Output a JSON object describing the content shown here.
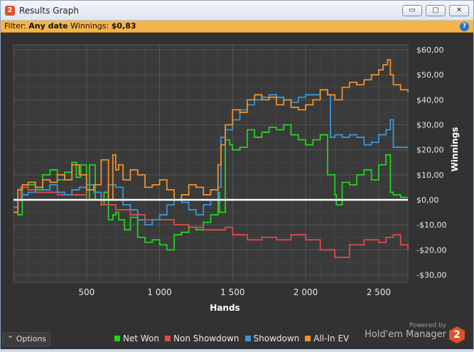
{
  "window": {
    "title": "Results Graph",
    "minimize": "▭",
    "maximize": "▢",
    "close": "✕",
    "app_icon": "2"
  },
  "filter": {
    "prefix": "Filter:",
    "value": "Any date",
    "winnings_label": "Winnings:",
    "winnings_value": "$0,83"
  },
  "help_icon": "?",
  "options_label": "Options",
  "brand": {
    "powered": "Powered by",
    "name": "Hold'em Manager",
    "logo": "2"
  },
  "colors": {
    "net_won": "#22d322",
    "non_showdown": "#e04a4a",
    "showdown": "#3b96d6",
    "all_in_ev": "#f0902c",
    "zero_line": "#ffffff"
  },
  "chart_data": {
    "type": "line",
    "title": "",
    "xlabel": "Hands",
    "ylabel": "Winnings",
    "xlim": [
      0,
      2700
    ],
    "ylim": [
      -33,
      62
    ],
    "xticks": [
      500,
      1000,
      1500,
      2000,
      2500
    ],
    "xtick_labels": [
      "500",
      "1 000",
      "1 500",
      "2 000",
      "2 500"
    ],
    "yticks": [
      60,
      50,
      40,
      30,
      20,
      10,
      0,
      -10,
      -20,
      -30
    ],
    "ytick_labels": [
      "$60,00",
      "$50,00",
      "$40,00",
      "$30,00",
      "$20,00",
      "$10,00",
      "$0,00",
      "-$10,00",
      "-$20,00",
      "-$30,00"
    ],
    "legend": {
      "position": "bottom"
    },
    "series": [
      {
        "name": "Net Won",
        "color": "#22d322",
        "x": [
          0,
          30,
          60,
          100,
          150,
          200,
          250,
          300,
          350,
          400,
          430,
          460,
          500,
          520,
          560,
          600,
          620,
          650,
          680,
          700,
          720,
          760,
          800,
          850,
          900,
          950,
          1000,
          1050,
          1100,
          1150,
          1200,
          1250,
          1300,
          1350,
          1400,
          1410,
          1450,
          1480,
          1500,
          1550,
          1600,
          1650,
          1700,
          1750,
          1800,
          1850,
          1900,
          1950,
          2000,
          2050,
          2100,
          2150,
          2200,
          2210,
          2250,
          2300,
          2350,
          2400,
          2450,
          2500,
          2550,
          2580,
          2600,
          2650,
          2700
        ],
        "y": [
          -3,
          -6,
          5,
          6,
          4,
          10,
          12,
          8,
          11,
          15,
          9,
          14,
          0,
          14,
          0,
          -2,
          3,
          -8,
          -6,
          -5,
          -8,
          -12,
          -7,
          -15,
          -17,
          -16,
          -18,
          -20,
          -14,
          -13,
          -11,
          -12,
          -9,
          -6,
          3,
          -5,
          24,
          22,
          20,
          21,
          28,
          25,
          27,
          29,
          28,
          30,
          26,
          24,
          22,
          24,
          26,
          10,
          2,
          -2,
          7,
          6,
          10,
          12,
          8,
          14,
          18,
          3,
          2,
          1,
          1
        ]
      },
      {
        "name": "Non Showdown",
        "color": "#e04a4a",
        "x": [
          0,
          50,
          100,
          150,
          200,
          300,
          400,
          500,
          600,
          700,
          800,
          900,
          1000,
          1100,
          1200,
          1300,
          1400,
          1450,
          1500,
          1600,
          1700,
          1800,
          1900,
          2000,
          2100,
          2200,
          2300,
          2400,
          2500,
          2550,
          2600,
          2650,
          2700
        ],
        "y": [
          0,
          5,
          4,
          3,
          3,
          2,
          2,
          0,
          -2,
          -4,
          -6,
          -8,
          -8,
          -10,
          -11,
          -12,
          -12,
          -11,
          -14,
          -16,
          -15,
          -16,
          -14,
          -16,
          -20,
          -23,
          -18,
          -16,
          -17,
          -15,
          -14,
          -18,
          -20
        ]
      },
      {
        "name": "Showdown",
        "color": "#3b96d6",
        "x": [
          0,
          30,
          60,
          100,
          150,
          200,
          250,
          300,
          350,
          400,
          450,
          500,
          550,
          600,
          650,
          700,
          750,
          800,
          850,
          900,
          950,
          1000,
          1050,
          1100,
          1150,
          1200,
          1250,
          1300,
          1350,
          1400,
          1420,
          1450,
          1500,
          1550,
          1600,
          1650,
          1700,
          1750,
          1800,
          1850,
          1900,
          1950,
          2000,
          2050,
          2100,
          2150,
          2170,
          2200,
          2250,
          2300,
          2350,
          2400,
          2450,
          2500,
          2550,
          2580,
          2600,
          2650,
          2700
        ],
        "y": [
          -3,
          0,
          2,
          3,
          5,
          4,
          6,
          3,
          2,
          4,
          5,
          6,
          3,
          0,
          6,
          5,
          -2,
          -4,
          -8,
          -10,
          -8,
          -6,
          -2,
          0,
          -1,
          -4,
          -6,
          -2,
          0,
          5,
          25,
          28,
          32,
          36,
          38,
          40,
          41,
          42,
          41,
          40,
          39,
          41,
          42,
          42,
          44,
          42,
          25,
          26,
          25,
          26,
          25,
          22,
          23,
          26,
          28,
          32,
          21,
          21,
          21
        ]
      },
      {
        "name": "All-In EV",
        "color": "#f0902c",
        "x": [
          0,
          30,
          60,
          100,
          150,
          200,
          250,
          300,
          350,
          400,
          450,
          500,
          550,
          600,
          650,
          680,
          700,
          720,
          750,
          800,
          850,
          900,
          950,
          1000,
          1050,
          1100,
          1150,
          1200,
          1250,
          1300,
          1350,
          1400,
          1420,
          1450,
          1500,
          1550,
          1600,
          1650,
          1700,
          1750,
          1800,
          1850,
          1900,
          1950,
          2000,
          2050,
          2100,
          2150,
          2200,
          2250,
          2300,
          2350,
          2400,
          2450,
          2500,
          2530,
          2560,
          2580,
          2600,
          2650,
          2700
        ],
        "y": [
          -5,
          4,
          6,
          7,
          5,
          8,
          7,
          10,
          8,
          14,
          10,
          4,
          6,
          16,
          0,
          18,
          12,
          14,
          8,
          12,
          10,
          5,
          6,
          8,
          4,
          0,
          2,
          6,
          5,
          2,
          4,
          14,
          22,
          30,
          36,
          35,
          40,
          42,
          40,
          41,
          38,
          40,
          37,
          36,
          38,
          40,
          44,
          42,
          40,
          45,
          47,
          46,
          48,
          50,
          52,
          54,
          56,
          50,
          46,
          44,
          43
        ]
      }
    ]
  }
}
